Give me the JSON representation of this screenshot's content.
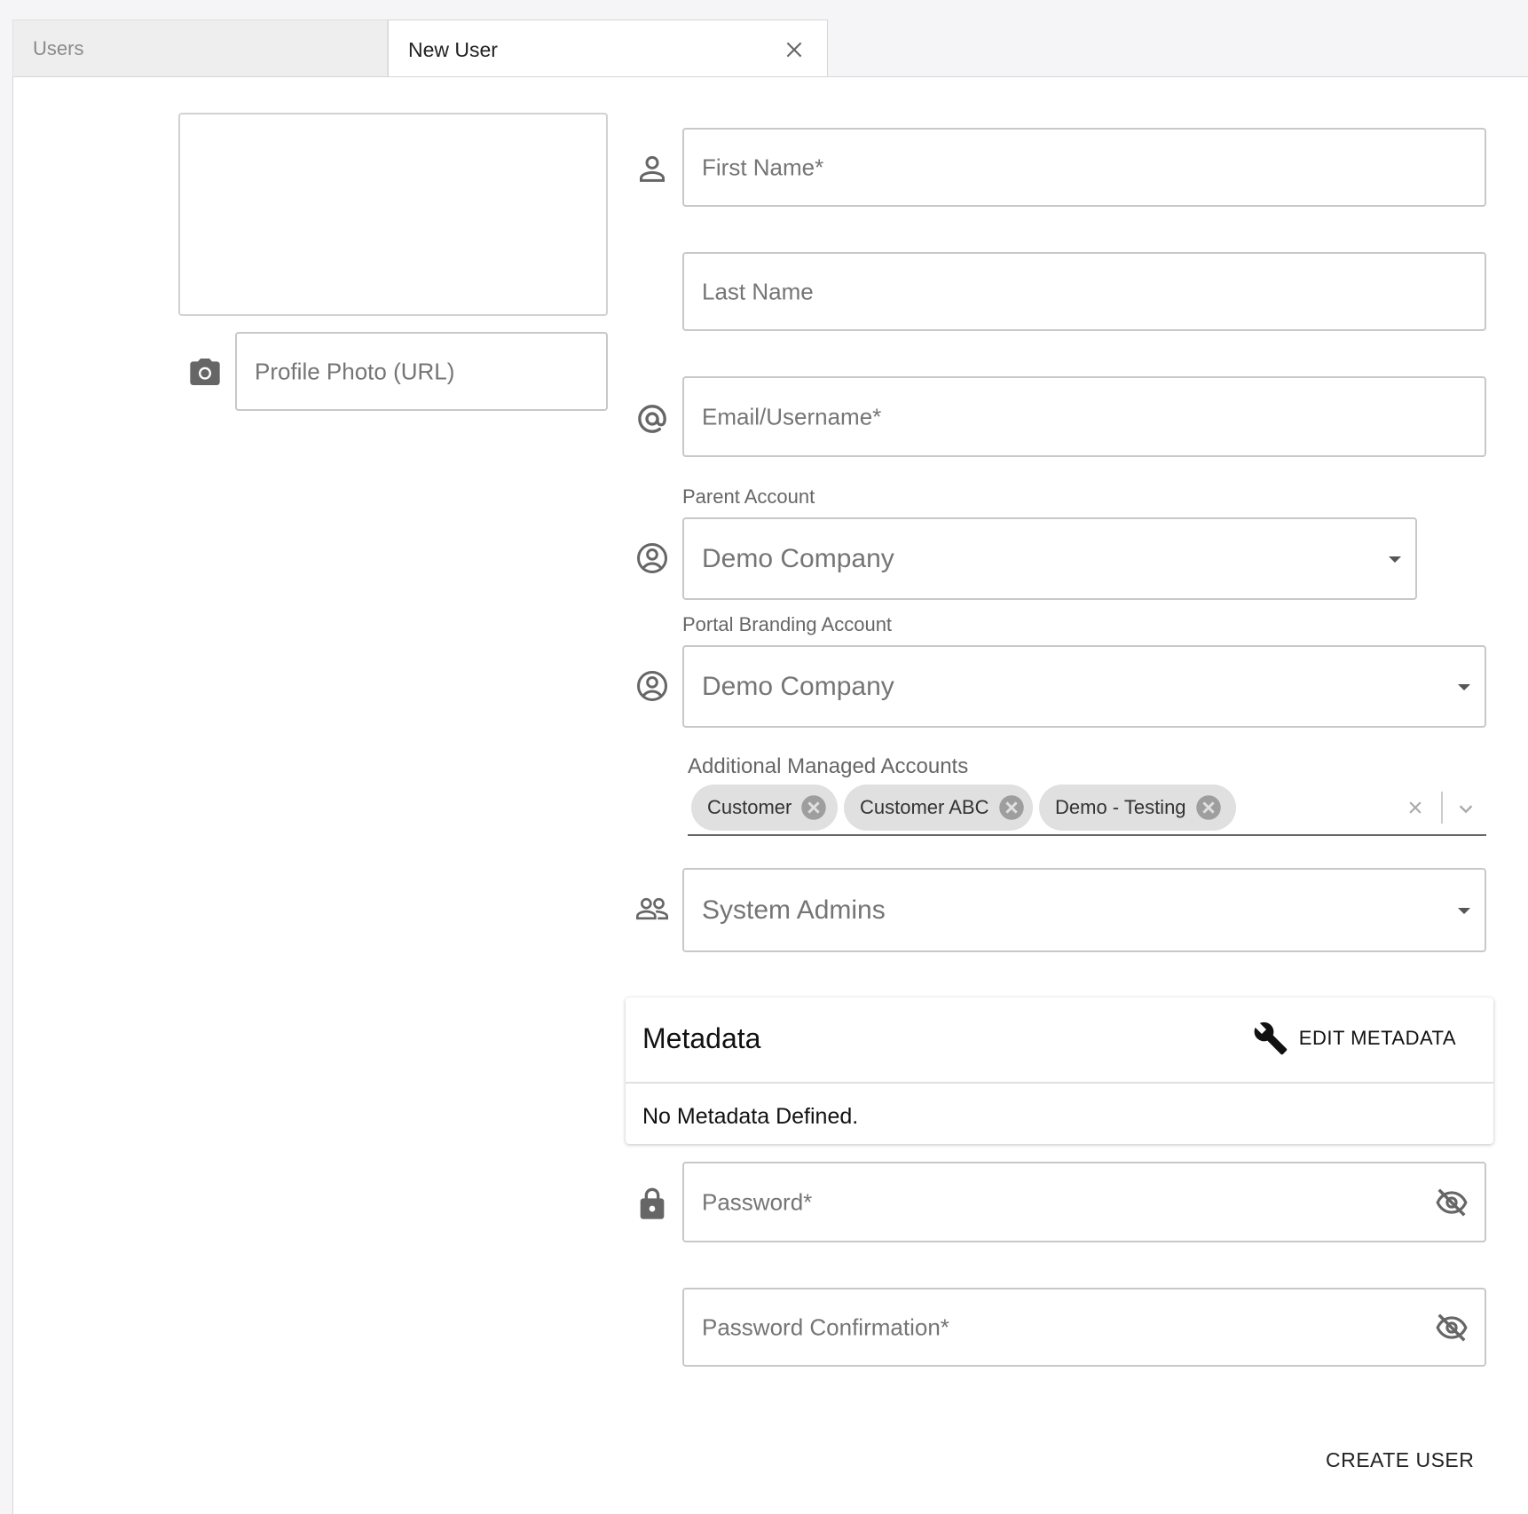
{
  "tabs": [
    {
      "label": "Users"
    },
    {
      "label": "New User"
    }
  ],
  "form": {
    "profile_photo_placeholder": "Profile Photo (URL)",
    "first_name_placeholder": "First Name*",
    "last_name_placeholder": "Last Name",
    "email_placeholder": "Email/Username*",
    "parent_account": {
      "label": "Parent Account",
      "value": "Demo Company"
    },
    "portal_branding_account": {
      "label": "Portal Branding Account",
      "value": "Demo Company"
    },
    "additional_managed_accounts": {
      "label": "Additional Managed Accounts",
      "chips": [
        "Customer",
        "Customer ABC",
        "Demo - Testing"
      ]
    },
    "group": {
      "value": "System Admins"
    },
    "metadata": {
      "title": "Metadata",
      "edit_button": "EDIT METADATA",
      "empty_text": "No Metadata Defined."
    },
    "password_placeholder": "Password*",
    "password_confirmation_placeholder": "Password Confirmation*",
    "create_button": "CREATE USER"
  },
  "icons": {
    "close": "close-icon",
    "person": "person-icon",
    "camera": "camera-icon",
    "at": "at-sign-icon",
    "account_circle": "account-circle-icon",
    "group": "group-icon",
    "wrench": "wrench-icon",
    "lock": "lock-icon",
    "visibility_off": "visibility-off-icon"
  }
}
